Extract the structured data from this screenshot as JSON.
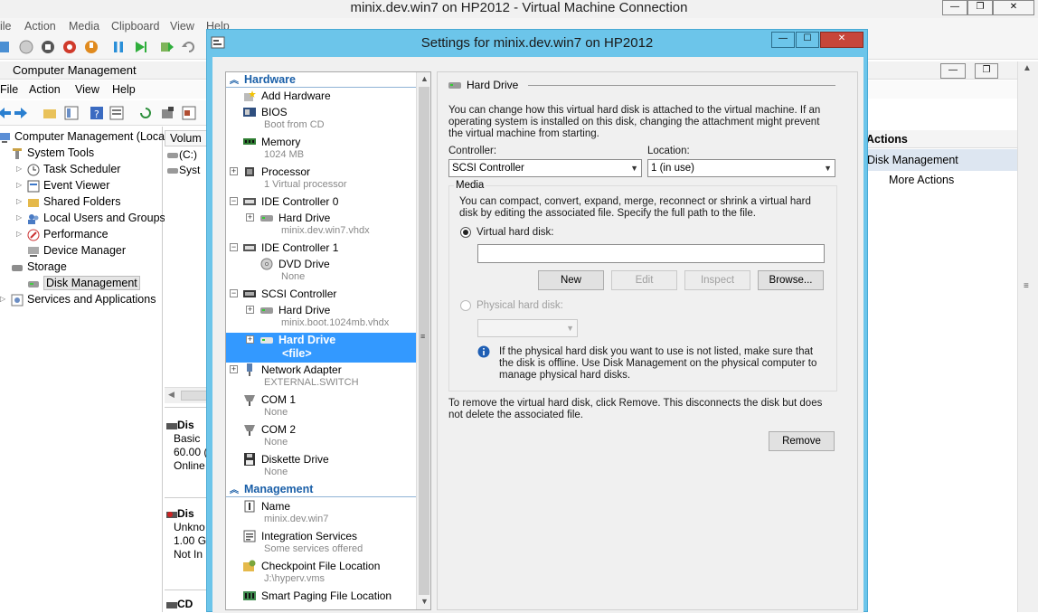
{
  "vm_window": {
    "title": "minix.dev.win7 on HP2012 - Virtual Machine Connection",
    "menu": [
      "ile",
      "Action",
      "Media",
      "Clipboard",
      "View",
      "Help"
    ]
  },
  "computer_management": {
    "title": "Computer Management",
    "menu": [
      "File",
      "Action",
      "View",
      "Help"
    ],
    "tree": [
      {
        "label": "Computer Management (Local",
        "icon": "computer-management-icon"
      },
      {
        "label": "System Tools",
        "icon": "tools-icon"
      },
      {
        "label": "Task Scheduler",
        "icon": "clock-icon"
      },
      {
        "label": "Event Viewer",
        "icon": "event-viewer-icon"
      },
      {
        "label": "Shared Folders",
        "icon": "folder-icon"
      },
      {
        "label": "Local Users and Groups",
        "icon": "users-icon"
      },
      {
        "label": "Performance",
        "icon": "performance-icon"
      },
      {
        "label": "Device Manager",
        "icon": "device-manager-icon"
      },
      {
        "label": "Storage",
        "icon": "storage-icon"
      },
      {
        "label": "Disk Management",
        "icon": "disk-icon"
      },
      {
        "label": "Services and Applications",
        "icon": "services-icon"
      }
    ],
    "volume_header": "Volum",
    "volumes": [
      "(C:)",
      "Syst"
    ],
    "disk0": {
      "title": "Dis",
      "type": "Basic",
      "size": "60.00 (",
      "status": "Online"
    },
    "disk1": {
      "title": "Dis",
      "type": "Unkno",
      "size": "1.00 G",
      "status": "Not In"
    },
    "disk2": {
      "title": "CD"
    },
    "actions": {
      "header": "Actions",
      "section": "Disk Management",
      "more": "More Actions"
    }
  },
  "dialog": {
    "title": "Settings for minix.dev.win7 on HP2012",
    "hardware_header": "Hardware",
    "management_header": "Management",
    "hardware_items": [
      {
        "name": "Add Hardware",
        "sub": "",
        "icon": "add-hardware-icon"
      },
      {
        "name": "BIOS",
        "sub": "Boot from CD",
        "icon": "bios-icon"
      },
      {
        "name": "Memory",
        "sub": "1024 MB",
        "icon": "memory-icon"
      },
      {
        "name": "Processor",
        "sub": "1 Virtual processor",
        "icon": "processor-icon"
      },
      {
        "name": "IDE Controller 0",
        "sub": "",
        "icon": "ide-controller-icon"
      },
      {
        "name": "Hard Drive",
        "sub": "minix.dev.win7.vhdx",
        "icon": "hard-drive-icon"
      },
      {
        "name": "IDE Controller 1",
        "sub": "",
        "icon": "ide-controller-icon"
      },
      {
        "name": "DVD Drive",
        "sub": "None",
        "icon": "dvd-drive-icon"
      },
      {
        "name": "SCSI Controller",
        "sub": "",
        "icon": "scsi-controller-icon"
      },
      {
        "name": "Hard Drive",
        "sub": "minix.boot.1024mb.vhdx",
        "icon": "hard-drive-icon"
      },
      {
        "name": "Hard Drive",
        "sub": "<file>",
        "icon": "hard-drive-icon"
      },
      {
        "name": "Network Adapter",
        "sub": "EXTERNAL.SWITCH",
        "icon": "network-adapter-icon"
      },
      {
        "name": "COM 1",
        "sub": "None",
        "icon": "com-port-icon"
      },
      {
        "name": "COM 2",
        "sub": "None",
        "icon": "com-port-icon"
      },
      {
        "name": "Diskette Drive",
        "sub": "None",
        "icon": "diskette-icon"
      }
    ],
    "management_items": [
      {
        "name": "Name",
        "sub": "minix.dev.win7",
        "icon": "name-icon"
      },
      {
        "name": "Integration Services",
        "sub": "Some services offered",
        "icon": "integration-services-icon"
      },
      {
        "name": "Checkpoint File Location",
        "sub": "J:\\hyperv.vms",
        "icon": "checkpoint-icon"
      },
      {
        "name": "Smart Paging File Location",
        "sub": "",
        "icon": "smart-paging-icon"
      }
    ],
    "panel": {
      "section_title": "Hard Drive",
      "intro": "You can change how this virtual hard disk is attached to the virtual machine. If an operating system is installed on this disk, changing the attachment might prevent the virtual machine from starting.",
      "controller_label": "Controller:",
      "controller_value": "SCSI Controller",
      "location_label": "Location:",
      "location_value": "1 (in use)",
      "media_label": "Media",
      "media_text": "You can compact, convert, expand, merge, reconnect or shrink a virtual hard disk by editing the associated file. Specify the full path to the file.",
      "vhd_radio": "Virtual hard disk:",
      "vhd_path": "",
      "btn_new": "New",
      "btn_edit": "Edit",
      "btn_inspect": "Inspect",
      "btn_browse": "Browse...",
      "phys_radio": "Physical hard disk:",
      "phys_value": "",
      "info_text": "If the physical hard disk you want to use is not listed, make sure that the disk is offline. Use Disk Management on the physical computer to manage physical hard disks.",
      "remove_text": "To remove the virtual hard disk, click Remove. This disconnects the disk but does not delete the associated file.",
      "btn_remove": "Remove"
    }
  }
}
